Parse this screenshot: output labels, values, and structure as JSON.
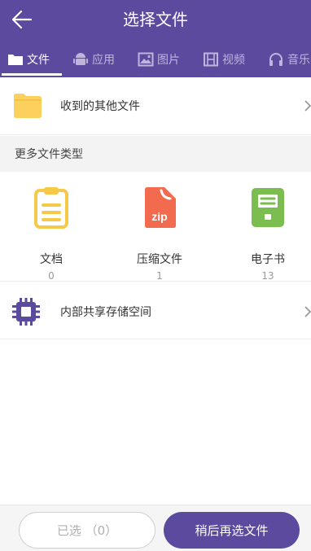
{
  "header": {
    "title": "选择文件",
    "background": "#5b4a9e",
    "back_icon": "arrow-left-icon"
  },
  "tabs": [
    {
      "label": "文件",
      "icon": "folder-icon",
      "active": true
    },
    {
      "label": "应用",
      "icon": "android-icon",
      "active": false
    },
    {
      "label": "图片",
      "icon": "image-icon",
      "active": false
    },
    {
      "label": "视频",
      "icon": "film-icon",
      "active": false
    },
    {
      "label": "音乐",
      "icon": "headphones-icon",
      "active": false
    }
  ],
  "received": {
    "label": "收到的其他文件",
    "icon": "folder-icon",
    "icon_color": "#fcd05c"
  },
  "more_types": {
    "header": "更多文件类型",
    "items": [
      {
        "name": "文档",
        "count": "0",
        "icon": "clipboard-document-icon",
        "color": "#f7c948"
      },
      {
        "name": "压缩文件",
        "count": "1",
        "icon": "zip-file-icon",
        "color": "#f36b4f",
        "badge": "zip"
      },
      {
        "name": "电子书",
        "count": "13",
        "icon": "ebook-icon",
        "color": "#7cbd4f"
      }
    ]
  },
  "storage": {
    "label": "内部共享存储空间",
    "icon": "chip-icon",
    "icon_color": "#5b4a9e"
  },
  "footer": {
    "selected_label": "已选 （0）",
    "later_label": "稍后再选文件"
  }
}
